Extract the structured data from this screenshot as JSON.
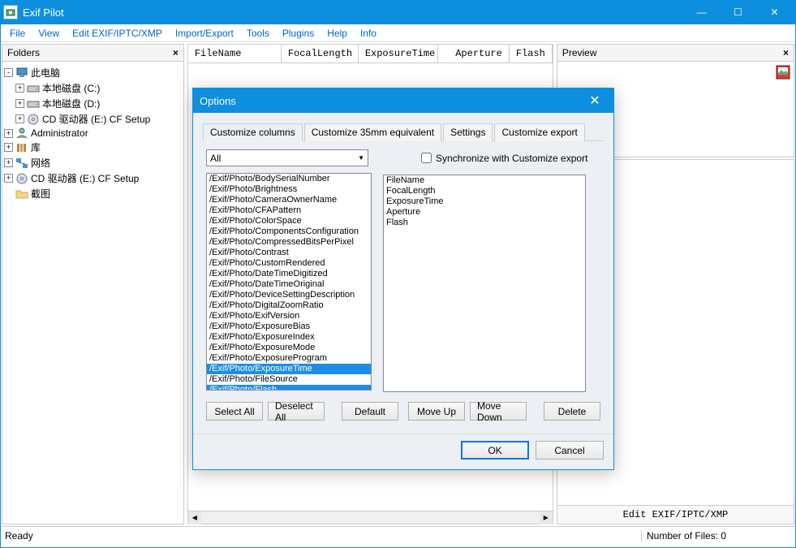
{
  "app": {
    "title": "Exif Pilot"
  },
  "window_controls": {
    "min": "—",
    "max": "☐",
    "close": "✕"
  },
  "menu": [
    "File",
    "View",
    "Edit EXIF/IPTC/XMP",
    "Import/Export",
    "Tools",
    "Plugins",
    "Help",
    "Info"
  ],
  "folders_panel": {
    "title": "Folders",
    "items": [
      {
        "label": "此电脑",
        "level": 0,
        "exp": "-",
        "icon": "pc"
      },
      {
        "label": "本地磁盘 (C:)",
        "level": 1,
        "exp": "+",
        "icon": "drive"
      },
      {
        "label": "本地磁盘 (D:)",
        "level": 1,
        "exp": "+",
        "icon": "drive"
      },
      {
        "label": "CD 驱动器 (E:) CF Setup",
        "level": 1,
        "exp": "+",
        "icon": "cd"
      },
      {
        "label": "Administrator",
        "level": 0,
        "exp": "+",
        "icon": "user"
      },
      {
        "label": "库",
        "level": 0,
        "exp": "+",
        "icon": "lib"
      },
      {
        "label": "网络",
        "level": 0,
        "exp": "+",
        "icon": "net"
      },
      {
        "label": "CD 驱动器 (E:) CF Setup",
        "level": 0,
        "exp": "+",
        "icon": "cd"
      },
      {
        "label": "截图",
        "level": 0,
        "exp": "",
        "icon": "folder"
      }
    ]
  },
  "columns": [
    "FileName",
    "FocalLength",
    "ExposureTime",
    "Aperture",
    "Flash"
  ],
  "preview_panel": {
    "title": "Preview"
  },
  "edit_button": "Edit EXIF/IPTC/XMP",
  "status": {
    "left": "Ready",
    "right": "Number of Files: 0"
  },
  "dialog": {
    "title": "Options",
    "tabs": [
      "Customize columns",
      "Customize 35mm equivalent",
      "Settings",
      "Customize export"
    ],
    "active_tab": 0,
    "dropdown_value": "All",
    "sync_label": "Synchronize with Customize export",
    "left_list": [
      "/Exif/Photo/BodySerialNumber",
      "/Exif/Photo/Brightness",
      "/Exif/Photo/CameraOwnerName",
      "/Exif/Photo/CFAPattern",
      "/Exif/Photo/ColorSpace",
      "/Exif/Photo/ComponentsConfiguration",
      "/Exif/Photo/CompressedBitsPerPixel",
      "/Exif/Photo/Contrast",
      "/Exif/Photo/CustomRendered",
      "/Exif/Photo/DateTimeDigitized",
      "/Exif/Photo/DateTimeOriginal",
      "/Exif/Photo/DeviceSettingDescription",
      "/Exif/Photo/DigitalZoomRatio",
      "/Exif/Photo/ExifVersion",
      "/Exif/Photo/ExposureBias",
      "/Exif/Photo/ExposureIndex",
      "/Exif/Photo/ExposureMode",
      "/Exif/Photo/ExposureProgram",
      "/Exif/Photo/ExposureTime",
      "/Exif/Photo/FileSource",
      "/Exif/Photo/Flash"
    ],
    "left_selected": [
      18,
      20
    ],
    "right_list": [
      "FileName",
      "FocalLength",
      "ExposureTime",
      "Aperture",
      "Flash"
    ],
    "buttons": {
      "select_all": "Select All",
      "deselect_all": "Deselect All",
      "default": "Default",
      "move_up": "Move Up",
      "move_down": "Move Down",
      "delete": "Delete",
      "ok": "OK",
      "cancel": "Cancel"
    }
  }
}
